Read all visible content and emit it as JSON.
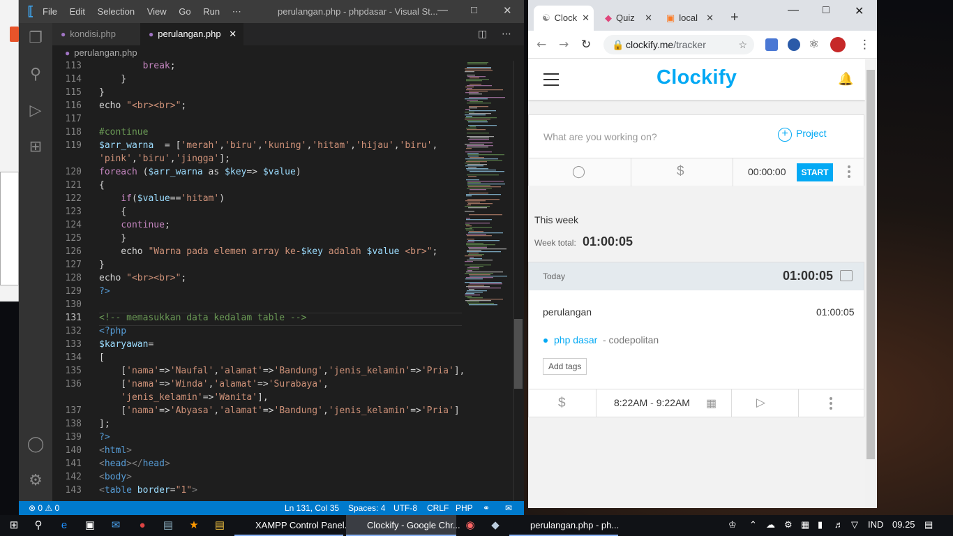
{
  "vscode": {
    "menu": [
      "File",
      "Edit",
      "Selection",
      "View",
      "Go",
      "Run",
      "⋯"
    ],
    "window_title": "perulangan.php - phpdasar - Visual St...",
    "tabs": [
      {
        "label": "kondisi.php"
      },
      {
        "label": "perulangan.php",
        "close": "✕"
      }
    ],
    "breadcrumb": "perulangan.php",
    "lines": [
      {
        "n": "113",
        "html": "        <span class=\"k\">break</span>;"
      },
      {
        "n": "114",
        "html": "    }"
      },
      {
        "n": "115",
        "html": "}"
      },
      {
        "n": "116",
        "html": "echo <span class=\"s\">\"&lt;br&gt;&lt;br&gt;\"</span>;"
      },
      {
        "n": "117",
        "html": ""
      },
      {
        "n": "118",
        "html": "<span class=\"c\">#continue</span>"
      },
      {
        "n": "119",
        "html": "<span class=\"v\">$arr_warna</span>  = [<span class=\"s\">'merah'</span>,<span class=\"s\">'biru'</span>,<span class=\"s\">'kuning'</span>,<span class=\"s\">'hitam'</span>,<span class=\"s\">'hijau'</span>,<span class=\"s\">'biru'</span>,"
      },
      {
        "n": "",
        "html": "<span class=\"s\">'pink'</span>,<span class=\"s\">'biru'</span>,<span class=\"s\">'jingga'</span>];"
      },
      {
        "n": "120",
        "html": "<span class=\"k\">foreach</span> (<span class=\"v\">$arr_warna</span> as <span class=\"v\">$key</span>=&gt; <span class=\"v\">$value</span>)"
      },
      {
        "n": "121",
        "html": "{"
      },
      {
        "n": "122",
        "html": "    <span class=\"k\">if</span>(<span class=\"v\">$value</span>==<span class=\"s\">'hitam'</span>)"
      },
      {
        "n": "123",
        "html": "    {"
      },
      {
        "n": "124",
        "html": "    <span class=\"k\">continue</span>;"
      },
      {
        "n": "125",
        "html": "    }"
      },
      {
        "n": "126",
        "html": "    echo <span class=\"s\">\"Warna pada elemen array ke-</span><span class=\"v\">$key</span><span class=\"s\"> adalah </span><span class=\"v\">$value</span><span class=\"s\"> &lt;br&gt;\"</span>;"
      },
      {
        "n": "127",
        "html": "}"
      },
      {
        "n": "128",
        "html": "echo <span class=\"s\">\"&lt;br&gt;&lt;br&gt;\"</span>;"
      },
      {
        "n": "129",
        "html": "<span class=\"t\">?&gt;</span>"
      },
      {
        "n": "130",
        "html": ""
      },
      {
        "n": "131",
        "html": "<span class=\"c\">&lt;!-- memasukkan data kedalam table --&gt;</span>"
      },
      {
        "n": "132",
        "html": "<span class=\"t\">&lt;?php</span>"
      },
      {
        "n": "133",
        "html": "<span class=\"v\">$karyawan</span>="
      },
      {
        "n": "134",
        "html": "["
      },
      {
        "n": "135",
        "html": "    [<span class=\"s\">'nama'</span>=&gt;<span class=\"s\">'Naufal'</span>,<span class=\"s\">'alamat'</span>=&gt;<span class=\"s\">'Bandung'</span>,<span class=\"s\">'jenis_kelamin'</span>=&gt;<span class=\"s\">'Pria'</span>],"
      },
      {
        "n": "136",
        "html": "    [<span class=\"s\">'nama'</span>=&gt;<span class=\"s\">'Winda'</span>,<span class=\"s\">'alamat'</span>=&gt;<span class=\"s\">'Surabaya'</span>,"
      },
      {
        "n": "",
        "html": "    <span class=\"s\">'jenis_kelamin'</span>=&gt;<span class=\"s\">'Wanita'</span>],"
      },
      {
        "n": "137",
        "html": "    [<span class=\"s\">'nama'</span>=&gt;<span class=\"s\">'Abyasa'</span>,<span class=\"s\">'alamat'</span>=&gt;<span class=\"s\">'Bandung'</span>,<span class=\"s\">'jenis_kelamin'</span>=&gt;<span class=\"s\">'Pria'</span>]"
      },
      {
        "n": "138",
        "html": "];"
      },
      {
        "n": "139",
        "html": "<span class=\"t\">?&gt;</span>"
      },
      {
        "n": "140",
        "html": "<span class=\"tag\">&lt;</span><span class=\"t\">html</span><span class=\"tag\">&gt;</span>"
      },
      {
        "n": "141",
        "html": "<span class=\"tag\">&lt;</span><span class=\"t\">head</span><span class=\"tag\">&gt;&lt;/</span><span class=\"t\">head</span><span class=\"tag\">&gt;</span>"
      },
      {
        "n": "142",
        "html": "<span class=\"tag\">&lt;</span><span class=\"t\">body</span><span class=\"tag\">&gt;</span>"
      },
      {
        "n": "143",
        "html": "<span class=\"tag\">&lt;</span><span class=\"t\">table</span> <span class=\"v\">border</span>=<span class=\"s\">\"1\"</span><span class=\"tag\">&gt;</span>"
      }
    ],
    "status": {
      "problems": "⊗ 0 ⚠ 0",
      "position": "Ln 131, Col 35",
      "spaces": "Spaces: 4",
      "encoding": "UTF-8",
      "eol": "CRLF",
      "language": "PHP"
    }
  },
  "chrome": {
    "tabs": [
      {
        "label": "Clock",
        "close": "✕"
      },
      {
        "label": "Quiz",
        "close": "✕"
      },
      {
        "label": "local",
        "close": "✕"
      }
    ],
    "new_tab": "+",
    "url_host": "clockify.me",
    "url_path": "/tracker"
  },
  "clockify": {
    "logo": "Clockify",
    "description_placeholder": "What are you working on?",
    "project_label": "Project",
    "timer": "00:00:00",
    "start_label": "START",
    "week_label": "This week",
    "week_total_label": "Week total:",
    "week_total": "01:00:05",
    "day_label": "Today",
    "day_total": "01:00:05",
    "entry": {
      "description": "perulangan",
      "duration": "01:00:05",
      "project": "php dasar",
      "client": "- codepolitan",
      "add_tags": "Add tags",
      "start": "8:22AM",
      "dash": "-",
      "end": "9:22AM"
    }
  },
  "taskbar": {
    "apps": [
      {
        "label": "XAMPP Control Panel...",
        "color": "#fb7a24"
      },
      {
        "label": "Clockify - Google Chr...",
        "color": "#4285f4"
      },
      {
        "label": "perulangan.php - ph...",
        "color": "#3ea6f0"
      }
    ],
    "language": "IND",
    "time": "09.25"
  }
}
